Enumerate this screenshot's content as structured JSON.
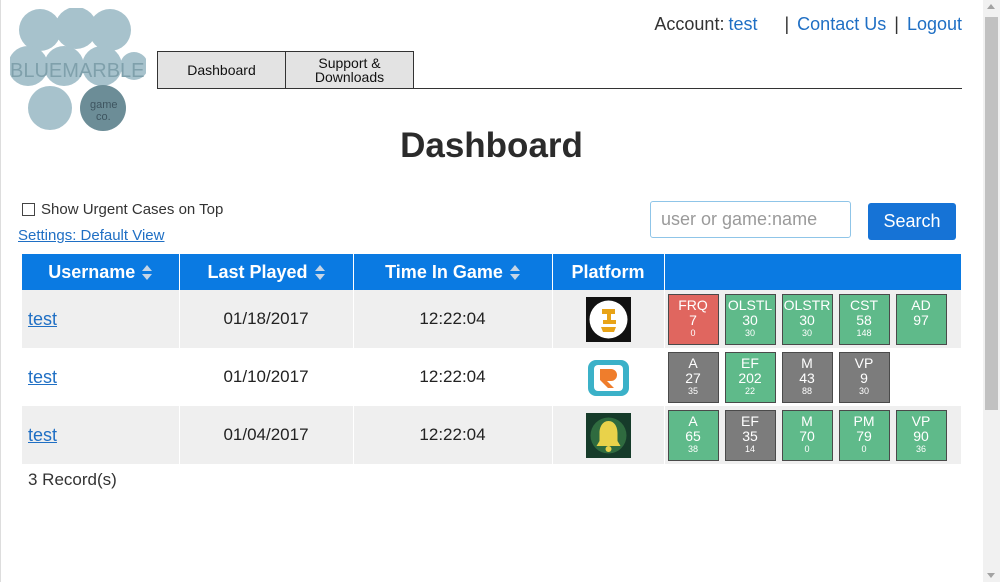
{
  "logo": {
    "line1": "BLUEMARBLE",
    "line2": "game",
    "line3": "co."
  },
  "account": {
    "label": "Account:",
    "user": "test",
    "contact": "Contact Us",
    "logout": "Logout"
  },
  "nav": {
    "tabs": [
      {
        "label": "Dashboard"
      },
      {
        "label": "Support & Downloads"
      }
    ]
  },
  "page_title": "Dashboard",
  "controls": {
    "urgent_label": "Show Urgent Cases on Top",
    "settings_link": "Settings: Default View",
    "search_placeholder": "user or game:name",
    "search_button": "Search"
  },
  "table": {
    "headers": {
      "username": "Username",
      "last_played": "Last Played",
      "time_in_game": "Time In Game",
      "platform": "Platform",
      "scores": ""
    },
    "rows": [
      {
        "username": "test",
        "last_played": "01/18/2017",
        "time_in_game": "12:22:04",
        "platform_icon": "game-icon-white",
        "badges": [
          {
            "label": "FRQ",
            "value": "7",
            "sub": "0",
            "color": "red"
          },
          {
            "label": "OLSTL",
            "value": "30",
            "sub": "30",
            "color": "green"
          },
          {
            "label": "OLSTR",
            "value": "30",
            "sub": "30",
            "color": "green"
          },
          {
            "label": "CST",
            "value": "58",
            "sub": "148",
            "color": "green"
          },
          {
            "label": "AD",
            "value": "97",
            "sub": "",
            "color": "green"
          }
        ]
      },
      {
        "username": "test",
        "last_played": "01/10/2017",
        "time_in_game": "12:22:04",
        "platform_icon": "game-icon-teal",
        "badges": [
          {
            "label": "A",
            "value": "27",
            "sub": "35",
            "color": "gray"
          },
          {
            "label": "EF",
            "value": "202",
            "sub": "22",
            "color": "green"
          },
          {
            "label": "M",
            "value": "43",
            "sub": "88",
            "color": "gray"
          },
          {
            "label": "VP",
            "value": "9",
            "sub": "30",
            "color": "gray"
          }
        ]
      },
      {
        "username": "test",
        "last_played": "01/04/2017",
        "time_in_game": "12:22:04",
        "platform_icon": "game-icon-bell",
        "badges": [
          {
            "label": "A",
            "value": "65",
            "sub": "38",
            "color": "green"
          },
          {
            "label": "EF",
            "value": "35",
            "sub": "14",
            "color": "gray"
          },
          {
            "label": "M",
            "value": "70",
            "sub": "0",
            "color": "green"
          },
          {
            "label": "PM",
            "value": "79",
            "sub": "0",
            "color": "green"
          },
          {
            "label": "VP",
            "value": "90",
            "sub": "36",
            "color": "green"
          }
        ]
      }
    ]
  },
  "records_text": "3 Record(s)",
  "colors": {
    "accent": "#0a7ae2",
    "link": "#1f6fc4",
    "badge_green": "#5fba8a",
    "badge_gray": "#7c7c7c",
    "badge_red": "#e0665f"
  }
}
